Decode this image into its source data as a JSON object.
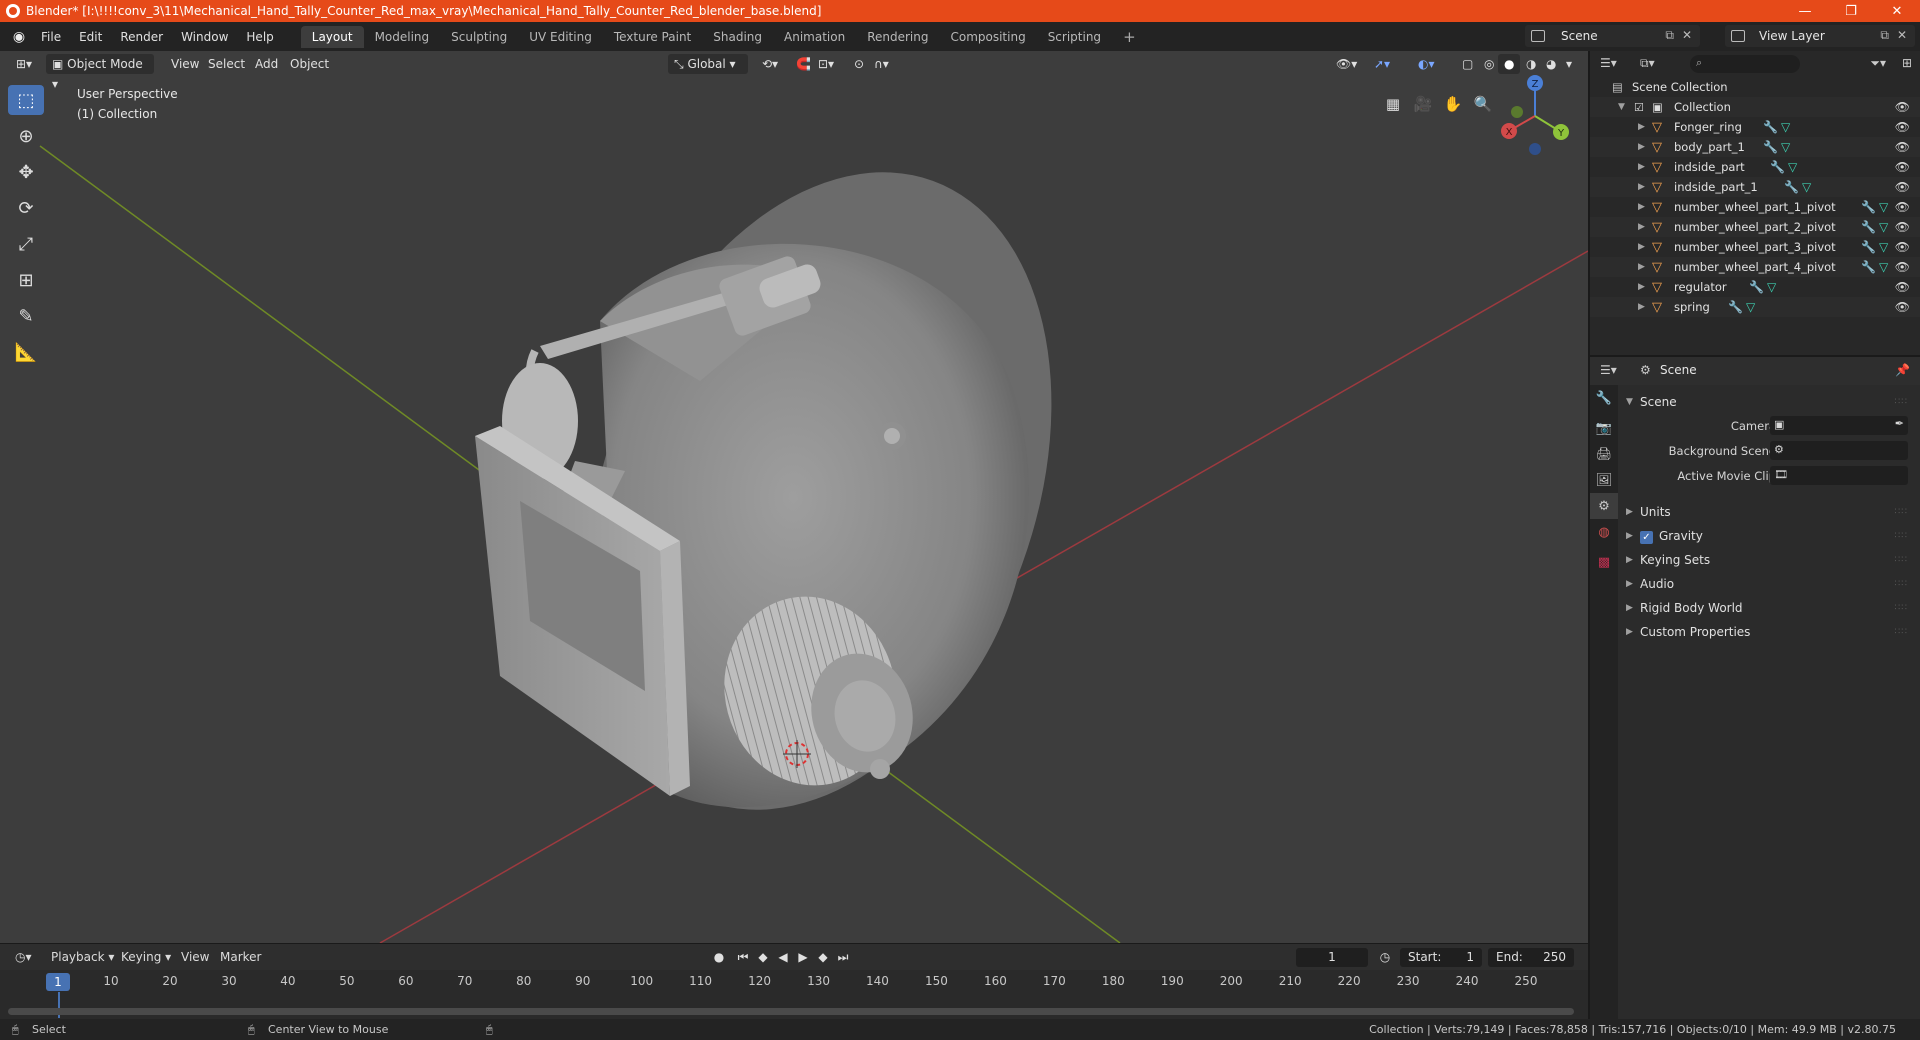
{
  "window": {
    "title": "Blender* [I:\\!!!!conv_3\\11\\Mechanical_Hand_Tally_Counter_Red_max_vray\\Mechanical_Hand_Tally_Counter_Red_blender_base.blend]",
    "minimize": "—",
    "maximize": "❐",
    "close": "✕"
  },
  "menu": [
    "File",
    "Edit",
    "Render",
    "Window",
    "Help"
  ],
  "workspaces": [
    "Layout",
    "Modeling",
    "Sculpting",
    "UV Editing",
    "Texture Paint",
    "Shading",
    "Animation",
    "Rendering",
    "Compositing",
    "Scripting",
    "+"
  ],
  "scene_name": "Scene",
  "view_layer_name": "View Layer",
  "viewport": {
    "mode": "Object Mode",
    "menus": [
      "View",
      "Select",
      "Add",
      "Object"
    ],
    "orientation": "Global",
    "overlay_line1": "User Perspective",
    "overlay_line2": "(1) Collection",
    "gizmo_axes": {
      "x": "X",
      "y": "Y",
      "z": "Z"
    }
  },
  "outliner": {
    "root": "Scene Collection",
    "collection": "Collection",
    "objects": [
      "Fonger_ring",
      "body_part_1",
      "indside_part",
      "indside_part_1",
      "number_wheel_part_1_pivot",
      "number_wheel_part_2_pivot",
      "number_wheel_part_3_pivot",
      "number_wheel_part_4_pivot",
      "regulator",
      "spring"
    ]
  },
  "properties": {
    "context": "Scene",
    "panel_title": "Scene",
    "fields": {
      "camera": "Camera",
      "background_scene": "Background Scene",
      "active_movie_clip": "Active Movie Clip"
    },
    "sections": [
      "Units",
      "Gravity",
      "Keying Sets",
      "Audio",
      "Rigid Body World",
      "Custom Properties"
    ]
  },
  "timeline": {
    "menus": [
      "Playback",
      "Keying",
      "View",
      "Marker"
    ],
    "current_frame": "1",
    "start_label": "Start:",
    "start_value": "1",
    "end_label": "End:",
    "end_value": "250",
    "ticks": [
      "1",
      "10",
      "20",
      "30",
      "40",
      "50",
      "60",
      "70",
      "80",
      "90",
      "100",
      "110",
      "120",
      "130",
      "140",
      "150",
      "160",
      "170",
      "180",
      "190",
      "200",
      "210",
      "220",
      "230",
      "240",
      "250"
    ]
  },
  "statusbar": {
    "select": "Select",
    "center_view": "Center View to Mouse",
    "stats": "Collection | Verts:79,149 | Faces:78,858 | Tris:157,716 | Objects:0/10 | Mem: 49.9 MB | v2.80.75"
  }
}
